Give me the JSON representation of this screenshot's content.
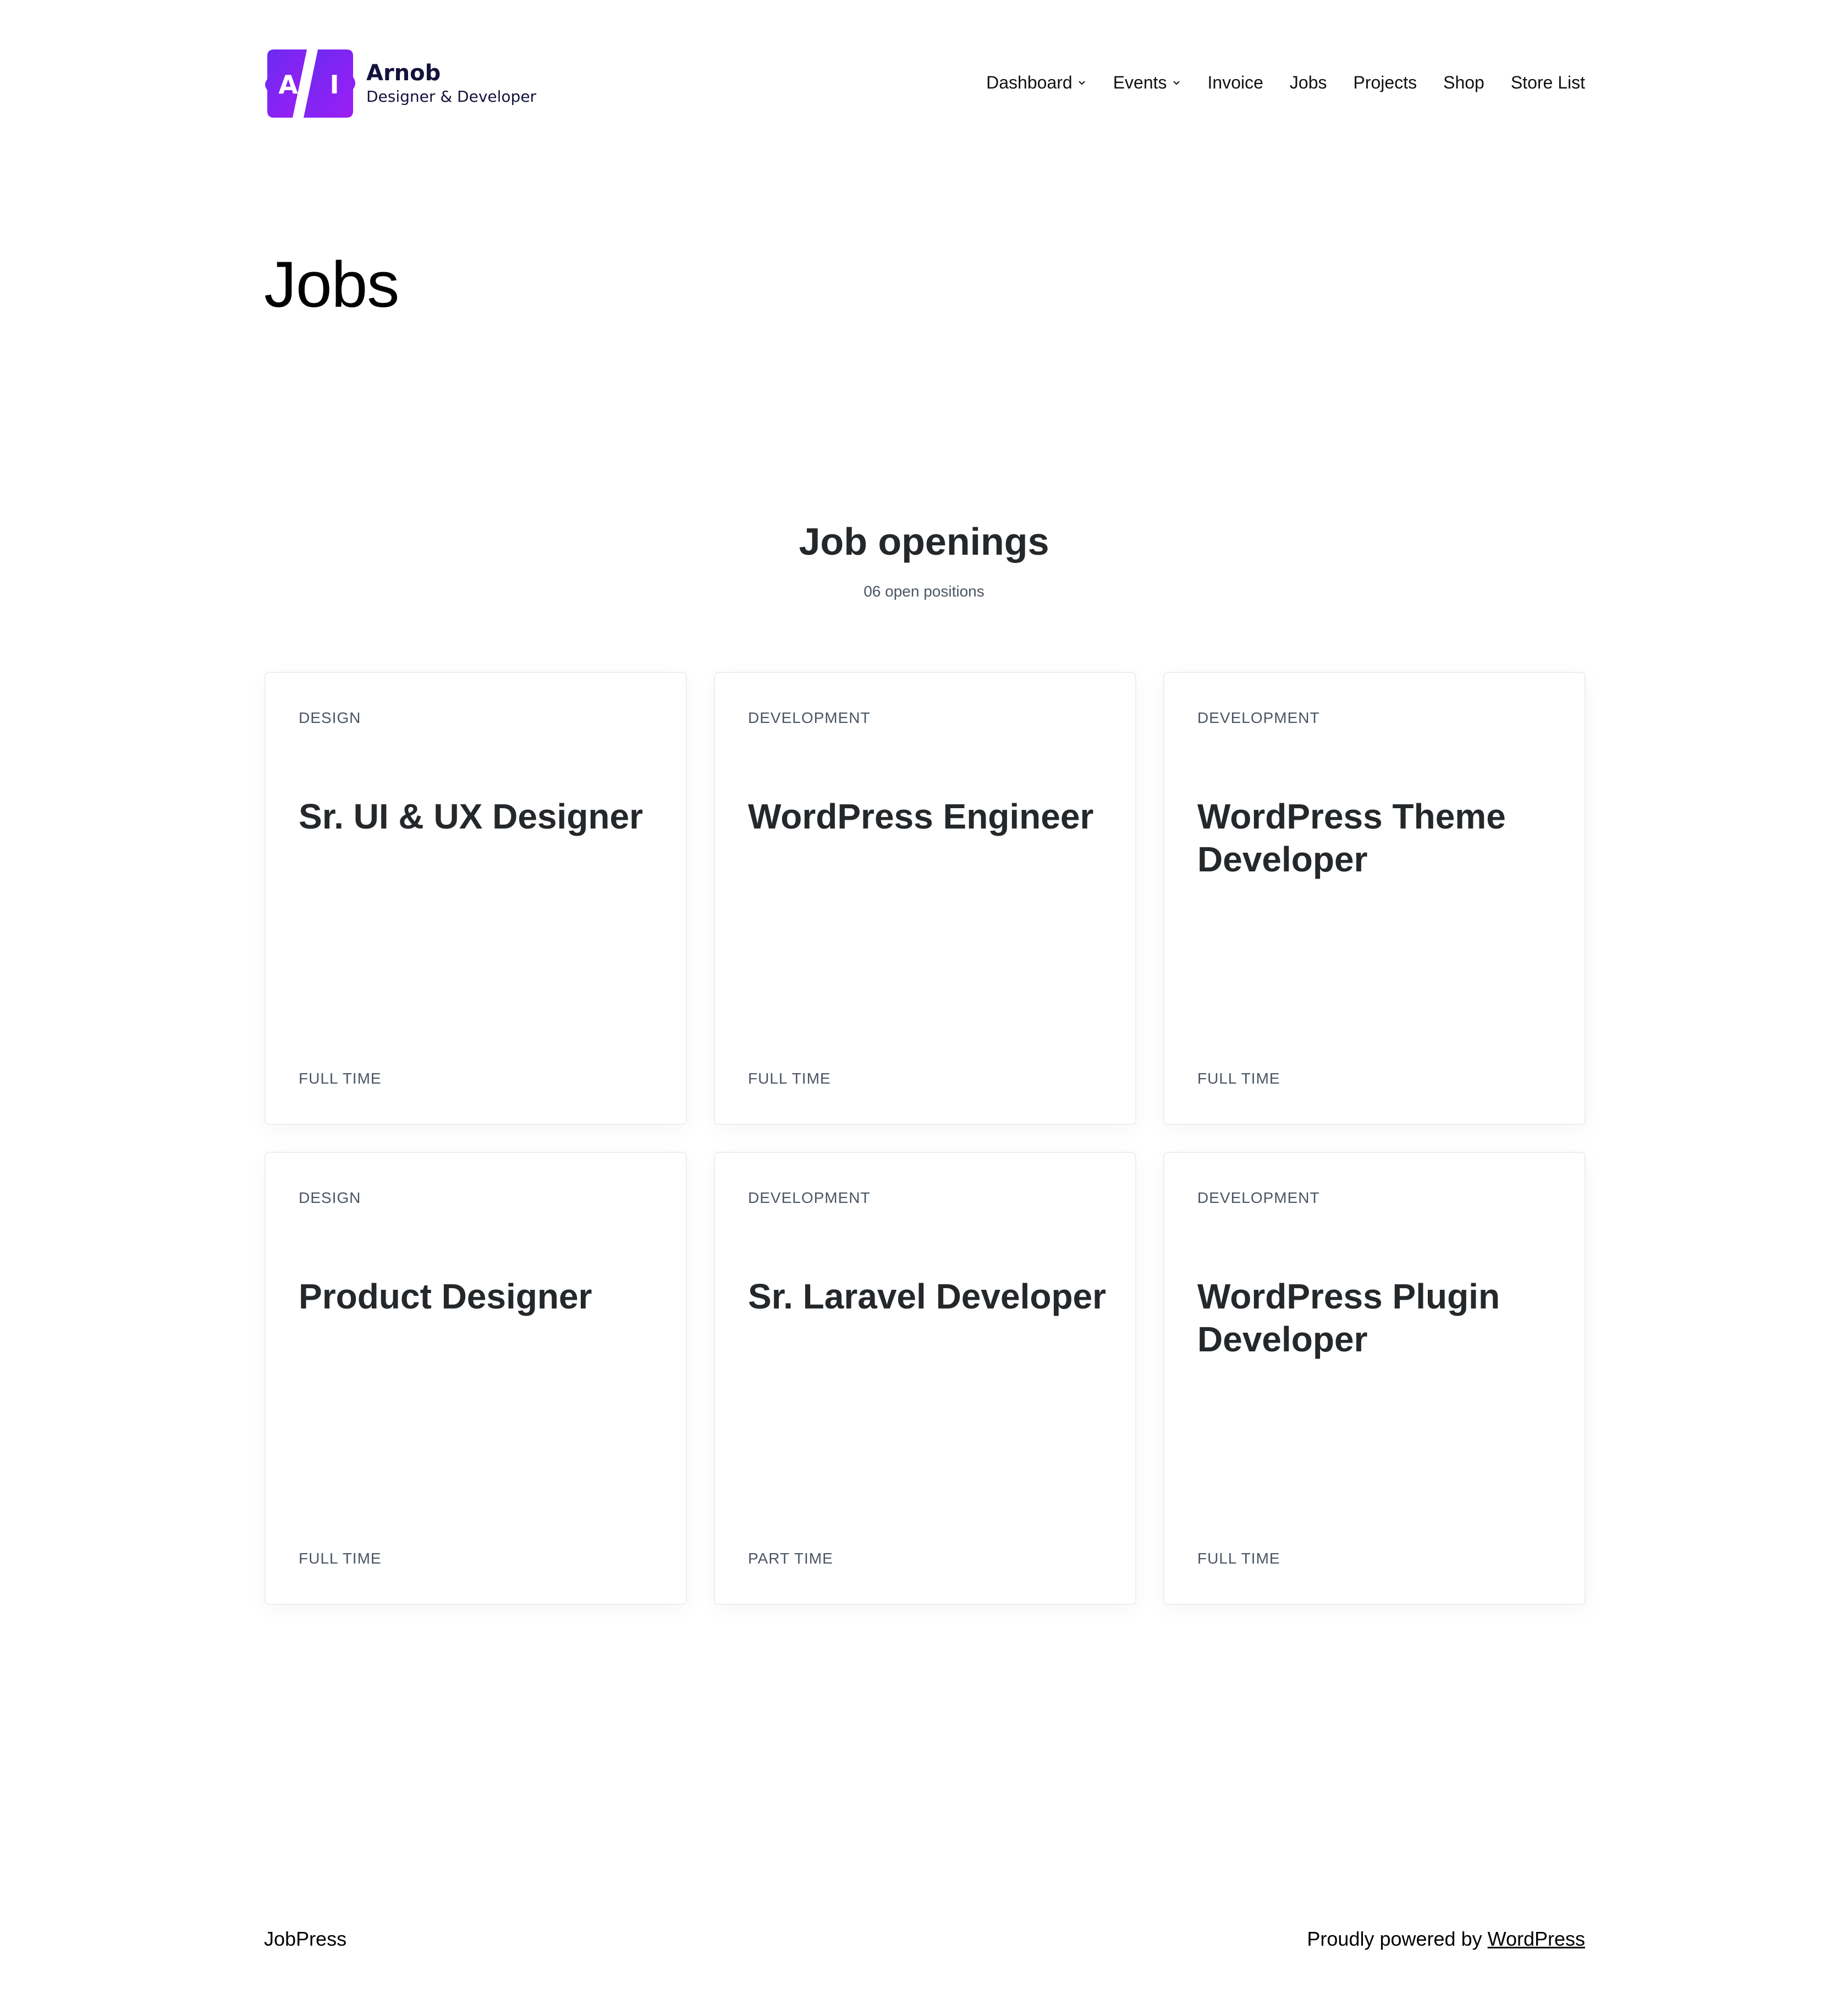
{
  "brand": {
    "logo_letters": [
      "A",
      "I"
    ],
    "name": "Arnob",
    "tagline": "Designer & Developer",
    "colors": {
      "logo_gradient_start": "#6a2bf0",
      "logo_gradient_end": "#9d1df5",
      "logo_text": "#14123d"
    }
  },
  "nav": {
    "items": [
      {
        "label": "Dashboard",
        "has_submenu": true
      },
      {
        "label": "Events",
        "has_submenu": true
      },
      {
        "label": "Invoice",
        "has_submenu": false
      },
      {
        "label": "Jobs",
        "has_submenu": false
      },
      {
        "label": "Projects",
        "has_submenu": false
      },
      {
        "label": "Shop",
        "has_submenu": false
      },
      {
        "label": "Store List",
        "has_submenu": false
      }
    ],
    "submenu_icon": "chevron-down-icon"
  },
  "page": {
    "title": "Jobs"
  },
  "openings": {
    "title": "Job openings",
    "subtitle": "06 open positions"
  },
  "jobs": [
    {
      "category": "DESIGN",
      "title": "Sr. UI & UX Designer",
      "type": "FULL TIME"
    },
    {
      "category": "DEVELOPMENT",
      "title": "WordPress Engineer",
      "type": "FULL TIME"
    },
    {
      "category": "DEVELOPMENT",
      "title": "WordPress Theme Developer",
      "type": "FULL TIME"
    },
    {
      "category": "DESIGN",
      "title": "Product Designer",
      "type": "FULL TIME"
    },
    {
      "category": "DEVELOPMENT",
      "title": "Sr. Laravel Developer",
      "type": "PART TIME"
    },
    {
      "category": "DEVELOPMENT",
      "title": "WordPress Plugin Developer",
      "type": "FULL TIME"
    }
  ],
  "footer": {
    "brand": "JobPress",
    "credit_prefix": "Proudly powered by",
    "credit_link": "WordPress"
  },
  "colors": {
    "heading_text": "#25282b",
    "muted_text": "#4b5563",
    "card_border": "#eceef1"
  }
}
